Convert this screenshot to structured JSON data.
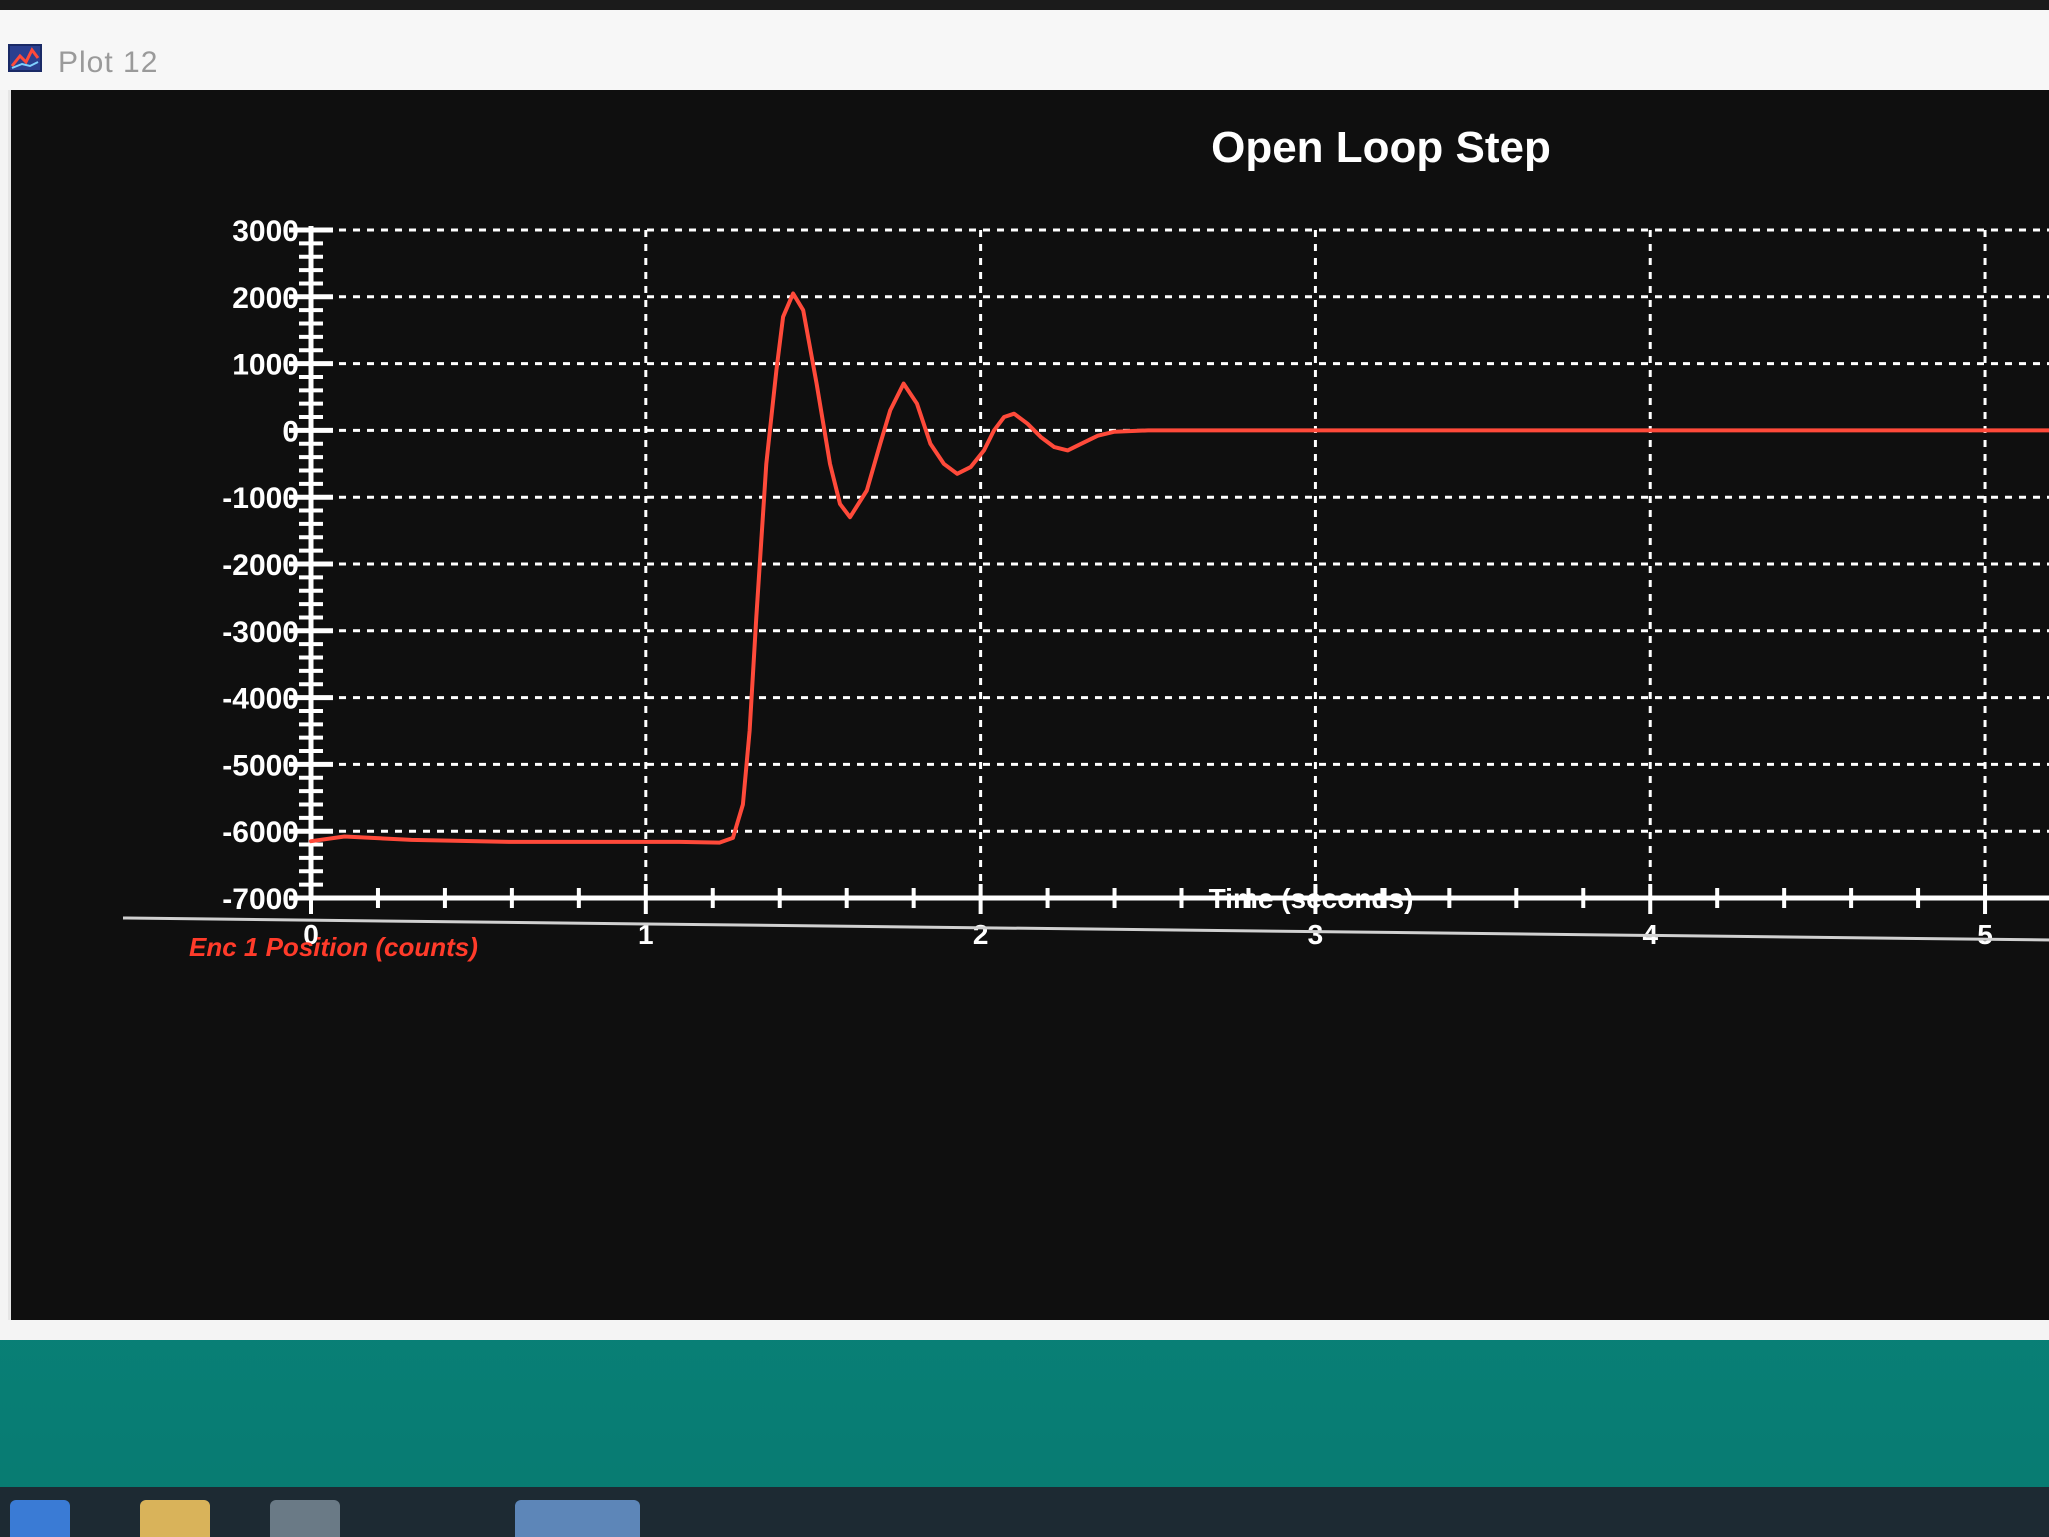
{
  "window": {
    "title": "Plot 12"
  },
  "colors": {
    "series": "#ff4a3a",
    "background": "#0f0f0f",
    "grid": "#ffffff",
    "text": "#ffffff",
    "legend_text": "#ff3b2a"
  },
  "chart_data": {
    "type": "line",
    "title": "Open Loop Step",
    "xlabel": "Time (seconds)",
    "ylabel": "",
    "xlim": [
      0,
      5.2
    ],
    "ylim": [
      -7000,
      3000
    ],
    "x_ticks": [
      0,
      1,
      2,
      3,
      4,
      5
    ],
    "x_tick_labels": [
      "0",
      "1",
      "2",
      "3",
      "4",
      "5"
    ],
    "y_ticks": [
      3000,
      2000,
      1000,
      0,
      -1000,
      -2000,
      -3000,
      -4000,
      -5000,
      -6000,
      -7000
    ],
    "y_tick_labels": [
      "3000",
      "2000",
      "1000",
      "0",
      "-1000",
      "-2000",
      "-3000",
      "-4000",
      "-5000",
      "-6000",
      "-7000"
    ],
    "grid": true,
    "legend_position": "bottom-left",
    "series": [
      {
        "name": "Enc 1 Position (counts)",
        "x": [
          0,
          0.1,
          0.3,
          0.6,
          0.9,
          1.1,
          1.22,
          1.26,
          1.29,
          1.31,
          1.33,
          1.36,
          1.39,
          1.41,
          1.44,
          1.47,
          1.51,
          1.55,
          1.58,
          1.61,
          1.66,
          1.7,
          1.73,
          1.77,
          1.81,
          1.85,
          1.89,
          1.93,
          1.97,
          2.01,
          2.04,
          2.07,
          2.1,
          2.14,
          2.18,
          2.22,
          2.26,
          2.3,
          2.35,
          2.4,
          2.5,
          3.0,
          3.5,
          4.0,
          4.5,
          5.0,
          5.2
        ],
        "y": [
          -6150,
          -6080,
          -6130,
          -6160,
          -6160,
          -6160,
          -6170,
          -6100,
          -5600,
          -4500,
          -2800,
          -500,
          900,
          1700,
          2050,
          1800,
          700,
          -500,
          -1100,
          -1300,
          -900,
          -200,
          300,
          700,
          400,
          -200,
          -500,
          -650,
          -550,
          -300,
          0,
          200,
          250,
          100,
          -100,
          -250,
          -300,
          -200,
          -80,
          -20,
          0,
          0,
          0,
          0,
          0,
          0,
          0
        ]
      }
    ]
  }
}
